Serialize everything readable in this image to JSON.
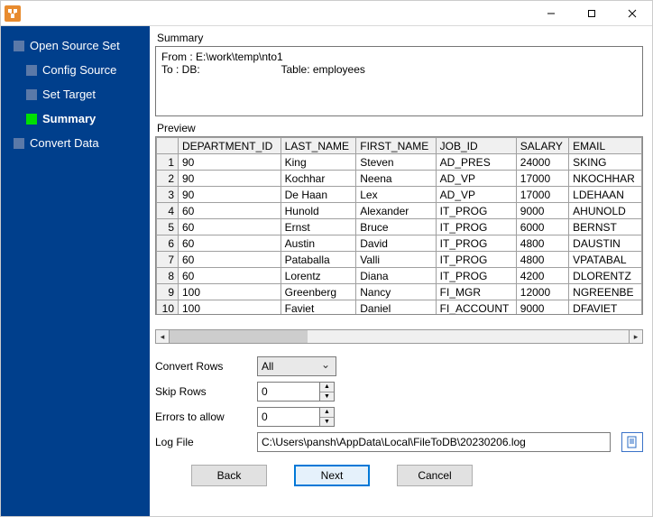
{
  "titlebar": {
    "title": ""
  },
  "sidebar": {
    "items": [
      {
        "label": "Open Source Set",
        "sub": false,
        "current": false
      },
      {
        "label": "Config Source",
        "sub": true,
        "current": false
      },
      {
        "label": "Set Target",
        "sub": true,
        "current": false
      },
      {
        "label": "Summary",
        "sub": true,
        "current": true
      },
      {
        "label": "Convert Data",
        "sub": false,
        "current": false
      }
    ]
  },
  "summary": {
    "heading": "Summary",
    "from_line": "From : E:\\work\\temp\\nto1",
    "to_db_label": "To : DB:",
    "table_label": "Table: employees"
  },
  "preview": {
    "heading": "Preview",
    "columns": [
      "DEPARTMENT_ID",
      "LAST_NAME",
      "FIRST_NAME",
      "JOB_ID",
      "SALARY",
      "EMAIL"
    ],
    "rows": [
      [
        "90",
        "King",
        "Steven",
        "AD_PRES",
        "24000",
        "SKING"
      ],
      [
        "90",
        "Kochhar",
        "Neena",
        "AD_VP",
        "17000",
        "NKOCHHAR"
      ],
      [
        "90",
        "De Haan",
        "Lex",
        "AD_VP",
        "17000",
        "LDEHAAN"
      ],
      [
        "60",
        "Hunold",
        "Alexander",
        "IT_PROG",
        "9000",
        "AHUNOLD"
      ],
      [
        "60",
        "Ernst",
        "Bruce",
        "IT_PROG",
        "6000",
        "BERNST"
      ],
      [
        "60",
        "Austin",
        "David",
        "IT_PROG",
        "4800",
        "DAUSTIN"
      ],
      [
        "60",
        "Pataballa",
        "Valli",
        "IT_PROG",
        "4800",
        "VPATABAL"
      ],
      [
        "60",
        "Lorentz",
        "Diana",
        "IT_PROG",
        "4200",
        "DLORENTZ"
      ],
      [
        "100",
        "Greenberg",
        "Nancy",
        "FI_MGR",
        "12000",
        "NGREENBE"
      ],
      [
        "100",
        "Faviet",
        "Daniel",
        "FI_ACCOUNT",
        "9000",
        "DFAVIET"
      ]
    ]
  },
  "form": {
    "convert_rows_label": "Convert Rows",
    "convert_rows_value": "All",
    "skip_rows_label": "Skip Rows",
    "skip_rows_value": "0",
    "errors_label": "Errors to allow",
    "errors_value": "0",
    "log_file_label": "Log File",
    "log_file_value": "C:\\Users\\pansh\\AppData\\Local\\FileToDB\\20230206.log"
  },
  "buttons": {
    "back": "Back",
    "next": "Next",
    "cancel": "Cancel"
  }
}
